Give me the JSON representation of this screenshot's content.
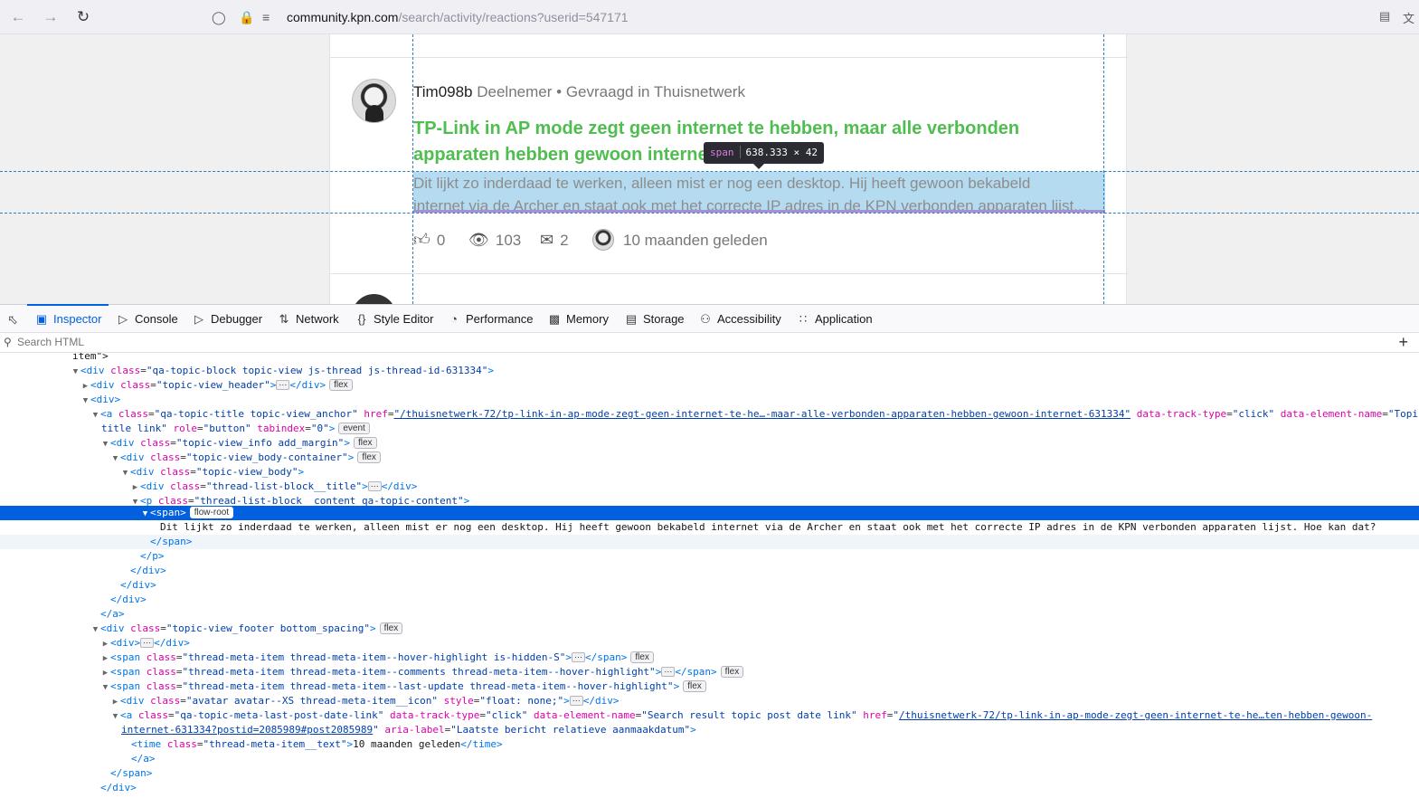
{
  "browser": {
    "url_host": "community.kpn.com",
    "url_path": "/search/activity/reactions?userid=547171"
  },
  "post": {
    "author": "Tim098b",
    "role": "Deelnemer",
    "bullet": "•",
    "asked_in": "Gevraagd in",
    "category": "Thuisnetwerk",
    "title": "TP-Link in AP mode zegt geen internet te hebben, maar alle verbonden apparaten hebben gewoon internet.",
    "help": "?",
    "excerpt_line1": "Dit lijkt zo inderdaad te werken, alleen mist er nog een desktop. Hij heeft gewoon bekabeld",
    "excerpt_line2": "internet via de Archer en staat ook met het correcte IP adres in de KPN verbonden apparaten lijst...",
    "likes": "0",
    "views": "103",
    "comments": "2",
    "last_update": "10 maanden geleden"
  },
  "highlighter": {
    "tag": "span",
    "size": "638.333 × 42"
  },
  "devtools": {
    "tabs": [
      {
        "label": "Inspector",
        "icon": "inspector-icon"
      },
      {
        "label": "Console",
        "icon": "console-icon"
      },
      {
        "label": "Debugger",
        "icon": "debugger-icon"
      },
      {
        "label": "Network",
        "icon": "network-icon"
      },
      {
        "label": "Style Editor",
        "icon": "style-editor-icon"
      },
      {
        "label": "Performance",
        "icon": "performance-icon"
      },
      {
        "label": "Memory",
        "icon": "memory-icon"
      },
      {
        "label": "Storage",
        "icon": "storage-icon"
      },
      {
        "label": "Accessibility",
        "icon": "accessibility-icon"
      },
      {
        "label": "Application",
        "icon": "application-icon"
      }
    ],
    "search_placeholder": "Search HTML",
    "add_label": "+"
  },
  "tree": {
    "l0": "item\">",
    "l1_tag": "<div ",
    "l1_attr": "class",
    "l1_val": "\"qa-topic-block topic-view js-thread js-thread-id-631334\"",
    "l1_end": ">",
    "l2_tag": "<div ",
    "l2_attr": "class",
    "l2_val": "\"topic-view_header\"",
    "l2_end": ">",
    "l2_close": "</div>",
    "l2_badge": "flex",
    "l3": "<div>",
    "l4_tag": "<a ",
    "l4_a1": "class",
    "l4_v1": "\"qa-topic-title topic-view_anchor\"",
    "l4_a2": "href",
    "l4_v2": "\"/thuisnetwerk-72/tp-link-in-ap-mode-zegt-geen-internet-te-he…-maar-alle-verbonden-apparaten-hebben-gewoon-internet-631334\"",
    "l4_a3": "data-track-type",
    "l4_v3": "\"click\"",
    "l4_a4": "data-element-name",
    "l4_v4": "\"Topi",
    "l5_v": "title link\"",
    "l5_a1": "role",
    "l5_v1": "\"button\"",
    "l5_a2": "tabindex",
    "l5_v2": "\"0\"",
    "l5_end": ">",
    "l5_badge": "event",
    "l6_tag": "<div ",
    "l6_attr": "class",
    "l6_val": "\"topic-view_info add_margin\"",
    "l6_end": ">",
    "l6_badge": "flex",
    "l7_tag": "<div ",
    "l7_attr": "class",
    "l7_val": "\"topic-view_body-container\"",
    "l7_end": ">",
    "l7_badge": "flex",
    "l8_tag": "<div ",
    "l8_attr": "class",
    "l8_val": "\"topic-view_body\"",
    "l8_end": ">",
    "l9_tag": "<div ",
    "l9_attr": "class",
    "l9_val": "\"thread-list-block__title\"",
    "l9_end": ">",
    "l9_close": "</div>",
    "l10_tag": "<p ",
    "l10_attr": "class",
    "l10_val": "\"thread-list-block__content qa-topic-content\"",
    "l10_end": ">",
    "l11_tag": "<span>",
    "l11_badge": "flow-root",
    "l12": "Dit lijkt zo inderdaad te werken, alleen mist er nog een desktop. Hij heeft gewoon bekabeld internet via de Archer en staat ook met het correcte IP adres in de KPN verbonden apparaten lijst. Hoe kan dat?",
    "l13": "</span>",
    "l14": "</p>",
    "l15": "</div>",
    "l16": "</div>",
    "l17": "</div>",
    "l18": "</a>",
    "l19_tag": "<div ",
    "l19_attr": "class",
    "l19_val": "\"topic-view_footer bottom_spacing\"",
    "l19_end": ">",
    "l19_badge": "flex",
    "l20_tag": "<div>",
    "l20_close": "</div>",
    "l21_tag": "<span ",
    "l21_attr": "class",
    "l21_val": "\"thread-meta-item thread-meta-item--hover-highlight is-hidden-S\"",
    "l21_end": ">",
    "l21_close": "</span>",
    "l21_badge": "flex",
    "l22_tag": "<span ",
    "l22_attr": "class",
    "l22_val": "\"thread-meta-item thread-meta-item--comments thread-meta-item--hover-highlight\"",
    "l22_end": ">",
    "l22_close": "</span>",
    "l22_badge": "flex",
    "l23_tag": "<span ",
    "l23_attr": "class",
    "l23_val": "\"thread-meta-item thread-meta-item--last-update thread-meta-item--hover-highlight\"",
    "l23_end": ">",
    "l23_badge": "flex",
    "l24_tag": "<div ",
    "l24_a1": "class",
    "l24_v1": "\"avatar avatar--XS thread-meta-item__icon\"",
    "l24_a2": "style",
    "l24_v2": "\"float: none;\"",
    "l24_end": ">",
    "l24_close": "</div>",
    "l25_tag": "<a ",
    "l25_a1": "class",
    "l25_v1": "\"qa-topic-meta-last-post-date-link\"",
    "l25_a2": "data-track-type",
    "l25_v2": "\"click\"",
    "l25_a3": "data-element-name",
    "l25_v3": "\"Search result topic post date link\"",
    "l25_a4": "href",
    "l25_v4a": "\"",
    "l25_v4": "/thuisnetwerk-72/tp-link-in-ap-mode-zegt-geen-internet-te-he…ten-hebben-gewoon-",
    "l26_v": "internet-631334?postid=2085989#post2085989",
    "l26_q": "\"",
    "l26_a": "aria-label",
    "l26_av": "\"Laatste bericht relatieve aanmaakdatum\"",
    "l26_end": ">",
    "l27_tag": "<time ",
    "l27_attr": "class",
    "l27_val": "\"thread-meta-item__text\"",
    "l27_end": ">",
    "l27_text": "10 maanden geleden",
    "l27_close": "</time>",
    "l28": "</a>",
    "l29": "</span>",
    "l30": "</div>"
  }
}
